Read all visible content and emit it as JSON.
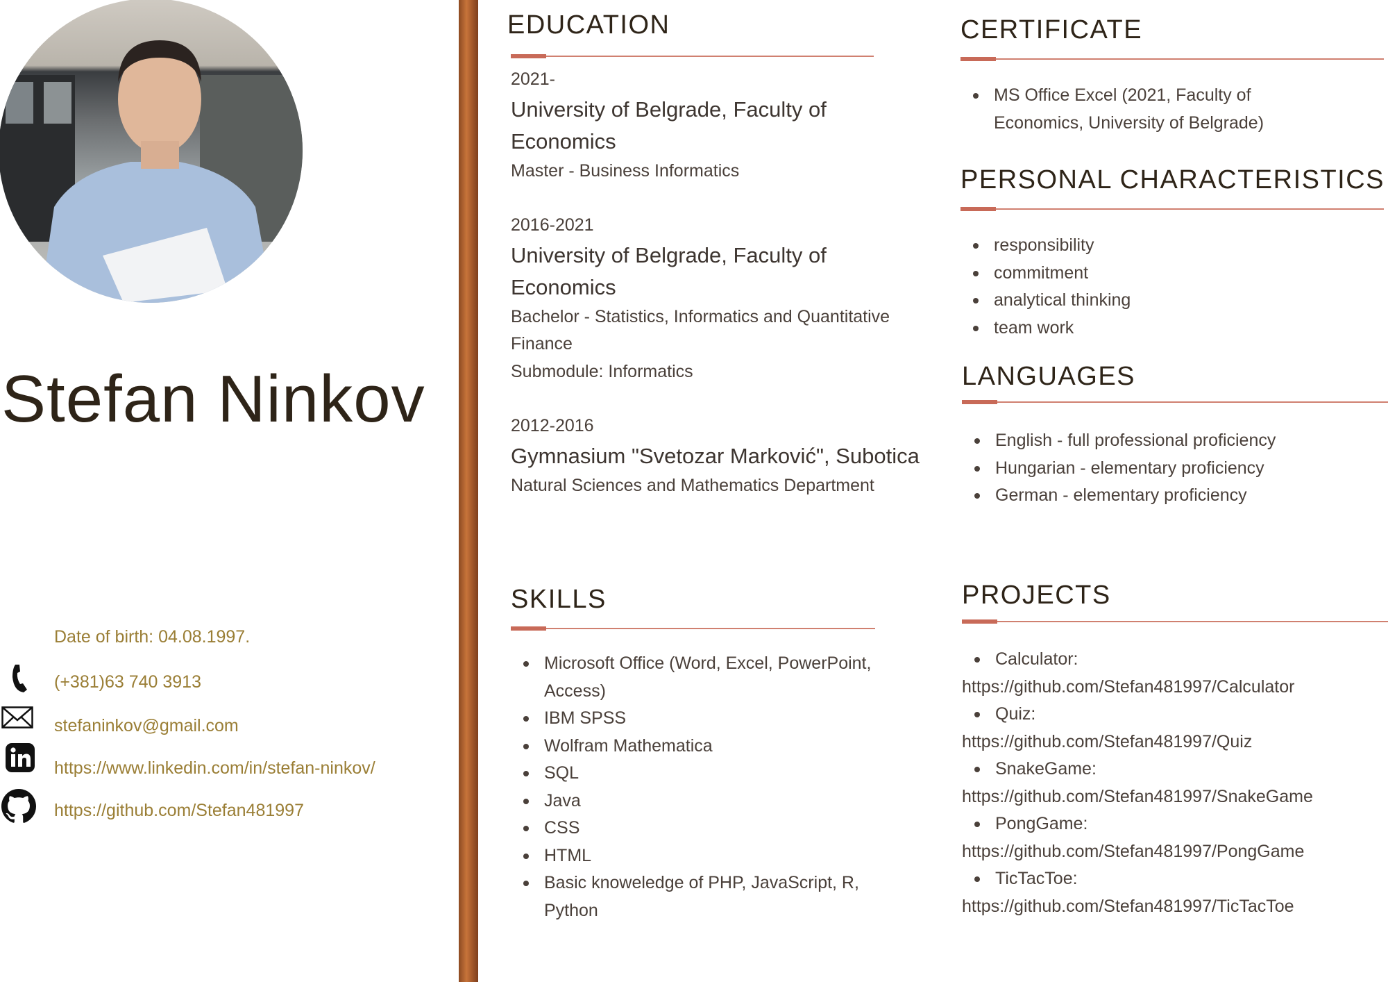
{
  "profile": {
    "name": "Stefan Ninkov",
    "photo_alt": "profile photo"
  },
  "contact": {
    "dob": "Date of birth: 04.08.1997.",
    "phone": "(+381)63 740 3913",
    "email": "stefaninkov@gmail.com",
    "linkedin": "https://www.linkedin.com/in/stefan-ninkov/",
    "github": "https://github.com/Stefan481997"
  },
  "colors": {
    "accent": "#c86a58",
    "link": "#9a7e35",
    "bar": "#a3582a"
  },
  "education": {
    "title": "EDUCATION",
    "entries": [
      {
        "years": "2021-",
        "school": [
          "University of Belgrade, Faculty of",
          "Economics"
        ],
        "details": [
          "Master - Business Informatics"
        ]
      },
      {
        "years": "2016-2021",
        "school": [
          "University of Belgrade, Faculty of",
          "Economics"
        ],
        "details": [
          "Bachelor - Statistics, Informatics and Quantitative",
          "Finance",
          "Submodule: Informatics"
        ]
      },
      {
        "years": "2012-2016",
        "school": [
          "Gymnasium \"Svetozar Marković\", Subotica"
        ],
        "details": [
          "Natural Sciences and Mathematics Department"
        ]
      }
    ]
  },
  "certificate": {
    "title": "CERTIFICATE",
    "items": [
      [
        "MS Office Excel (2021, Faculty of",
        "Economics, University of Belgrade)"
      ]
    ]
  },
  "personal": {
    "title": "PERSONAL CHARACTERISTICS",
    "items": [
      "responsibility",
      "commitment",
      "analytical thinking",
      "team work"
    ]
  },
  "languages": {
    "title": "LANGUAGES",
    "items": [
      "English - full professional proficiency",
      "Hungarian - elementary proficiency",
      "German - elementary proficiency"
    ]
  },
  "skills": {
    "title": "SKILLS",
    "items": [
      [
        "Microsoft Office (Word, Excel, PowerPoint,",
        "Access)"
      ],
      [
        "IBM SPSS"
      ],
      [
        "Wolfram Mathematica"
      ],
      [
        "SQL"
      ],
      [
        "Java"
      ],
      [
        "CSS"
      ],
      [
        "HTML"
      ],
      [
        "Basic knoweledge of PHP, JavaScript, R,",
        "Python"
      ]
    ]
  },
  "projects": {
    "title": "PROJECTS",
    "items": [
      {
        "name": "Calculator:",
        "url": "https://github.com/Stefan481997/Calculator"
      },
      {
        "name": "Quiz:",
        "url": "https://github.com/Stefan481997/Quiz"
      },
      {
        "name": "SnakeGame:",
        "url": "https://github.com/Stefan481997/SnakeGame"
      },
      {
        "name": "PongGame:",
        "url": "https://github.com/Stefan481997/PongGame"
      },
      {
        "name": "TicTacToe:",
        "url": "https://github.com/Stefan481997/TicTacToe"
      }
    ]
  }
}
